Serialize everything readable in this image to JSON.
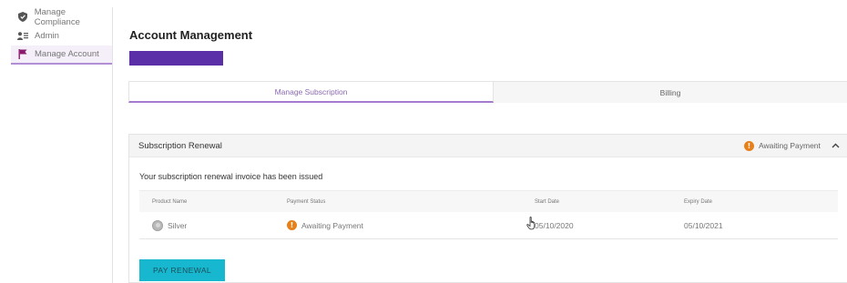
{
  "sidebar": {
    "items": [
      {
        "label": "Manage Compliance",
        "icon": "shield-icon"
      },
      {
        "label": "Admin",
        "icon": "users-icon"
      },
      {
        "label": "Manage Account",
        "icon": "flag-icon"
      }
    ]
  },
  "main": {
    "title": "Account Management",
    "brand_color": "#5a2fa7",
    "tabs": [
      {
        "label": "Manage Subscription"
      },
      {
        "label": "Billing"
      }
    ]
  },
  "renewal": {
    "title": "Subscription Renewal",
    "status": "Awaiting Payment",
    "status_icon": "!",
    "message": "Your subscription renewal invoice has been issued",
    "columns": [
      "Product Name",
      "Payment Status",
      "Start Date",
      "Expiry Date"
    ],
    "row": {
      "product": "Silver",
      "payment_status": "Awaiting Payment",
      "start_date": "05/10/2020",
      "expiry_date": "05/10/2021"
    },
    "pay_button": "PAY RENEWAL"
  },
  "colors": {
    "accent": "#a37cd0",
    "warning": "#e8801a",
    "button": "#17b8cf"
  }
}
